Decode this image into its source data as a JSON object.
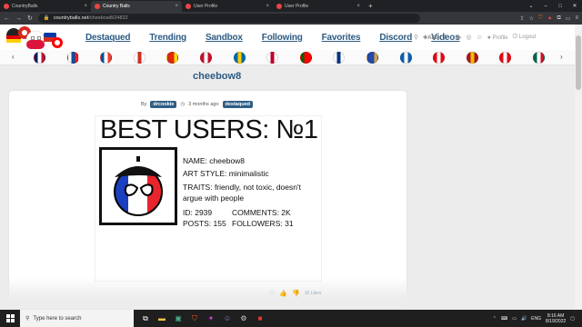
{
  "browser": {
    "tabs": [
      {
        "title": "CountryBalls",
        "active": false
      },
      {
        "title": "Country Balls",
        "active": true
      },
      {
        "title": "User Profile",
        "active": false
      },
      {
        "title": "User Profile",
        "active": false
      }
    ],
    "url_host": "countryballs.net",
    "url_path": "/cheebow8/24822"
  },
  "nav": {
    "items": [
      "Destaqued",
      "Trending",
      "Sandbox",
      "Following",
      "Favorites",
      "Discord",
      "Videos"
    ],
    "add_label": "ADD",
    "profile_label": "Profile",
    "logout_label": "Logout"
  },
  "flags": [
    {
      "name": "uk",
      "colors": [
        "#012169",
        "#fff",
        "#c8102e"
      ]
    },
    {
      "name": "slovenia",
      "colors": [
        "#fff",
        "#0b4ea2",
        "#ed1c24"
      ]
    },
    {
      "name": "france",
      "colors": [
        "#0055a4",
        "#fff",
        "#ef4135"
      ]
    },
    {
      "name": "canada-like",
      "colors": [
        "#fff",
        "#d52b1e",
        "#fff"
      ]
    },
    {
      "name": "china",
      "colors": [
        "#de2910",
        "#de2910",
        "#ffde00"
      ]
    },
    {
      "name": "denmark",
      "colors": [
        "#c8102e",
        "#fff",
        "#c8102e"
      ]
    },
    {
      "name": "sweden",
      "colors": [
        "#006aa7",
        "#fecc00",
        "#006aa7"
      ]
    },
    {
      "name": "japan",
      "colors": [
        "#fff",
        "#bc002d",
        "#fff"
      ]
    },
    {
      "name": "portugal",
      "colors": [
        "#006600",
        "#ff0000",
        "#ff0000"
      ]
    },
    {
      "name": "finland",
      "colors": [
        "#fff",
        "#003580",
        "#fff"
      ]
    },
    {
      "name": "kosovo",
      "colors": [
        "#244aa5",
        "#244aa5",
        "#d0a650"
      ]
    },
    {
      "name": "greece",
      "colors": [
        "#0d5eaf",
        "#fff",
        "#0d5eaf"
      ]
    },
    {
      "name": "turkey-red",
      "colors": [
        "#e30a17",
        "#fff",
        "#e30a17"
      ]
    },
    {
      "name": "spain",
      "colors": [
        "#aa151b",
        "#f1bf00",
        "#aa151b"
      ]
    },
    {
      "name": "turkey",
      "colors": [
        "#e30a17",
        "#fff",
        "#e30a17"
      ]
    },
    {
      "name": "mexico",
      "colors": [
        "#006847",
        "#fff",
        "#ce1126"
      ]
    }
  ],
  "page": {
    "title": "cheebow8",
    "by_label": "By",
    "author": "drcookie",
    "time": "3 months ago",
    "category": "destaqued"
  },
  "artwork": {
    "heading": "BEST USERS: №1",
    "name": "NAME: cheebow8",
    "art_style": "ART STYLE: minimalistic",
    "traits": "TRAITS: friendly, not toxic, doesn't argue with people",
    "id": "ID: 2939",
    "comments": "COMMENTS: 2K",
    "posts": "POSTS: 155",
    "followers": "FOLLOWERS: 31"
  },
  "likes": {
    "label": "10 Likes"
  },
  "taskbar": {
    "search_placeholder": "Type here to search",
    "time": "8:16 AM",
    "date": "8/19/2022",
    "lang": "ENG"
  }
}
